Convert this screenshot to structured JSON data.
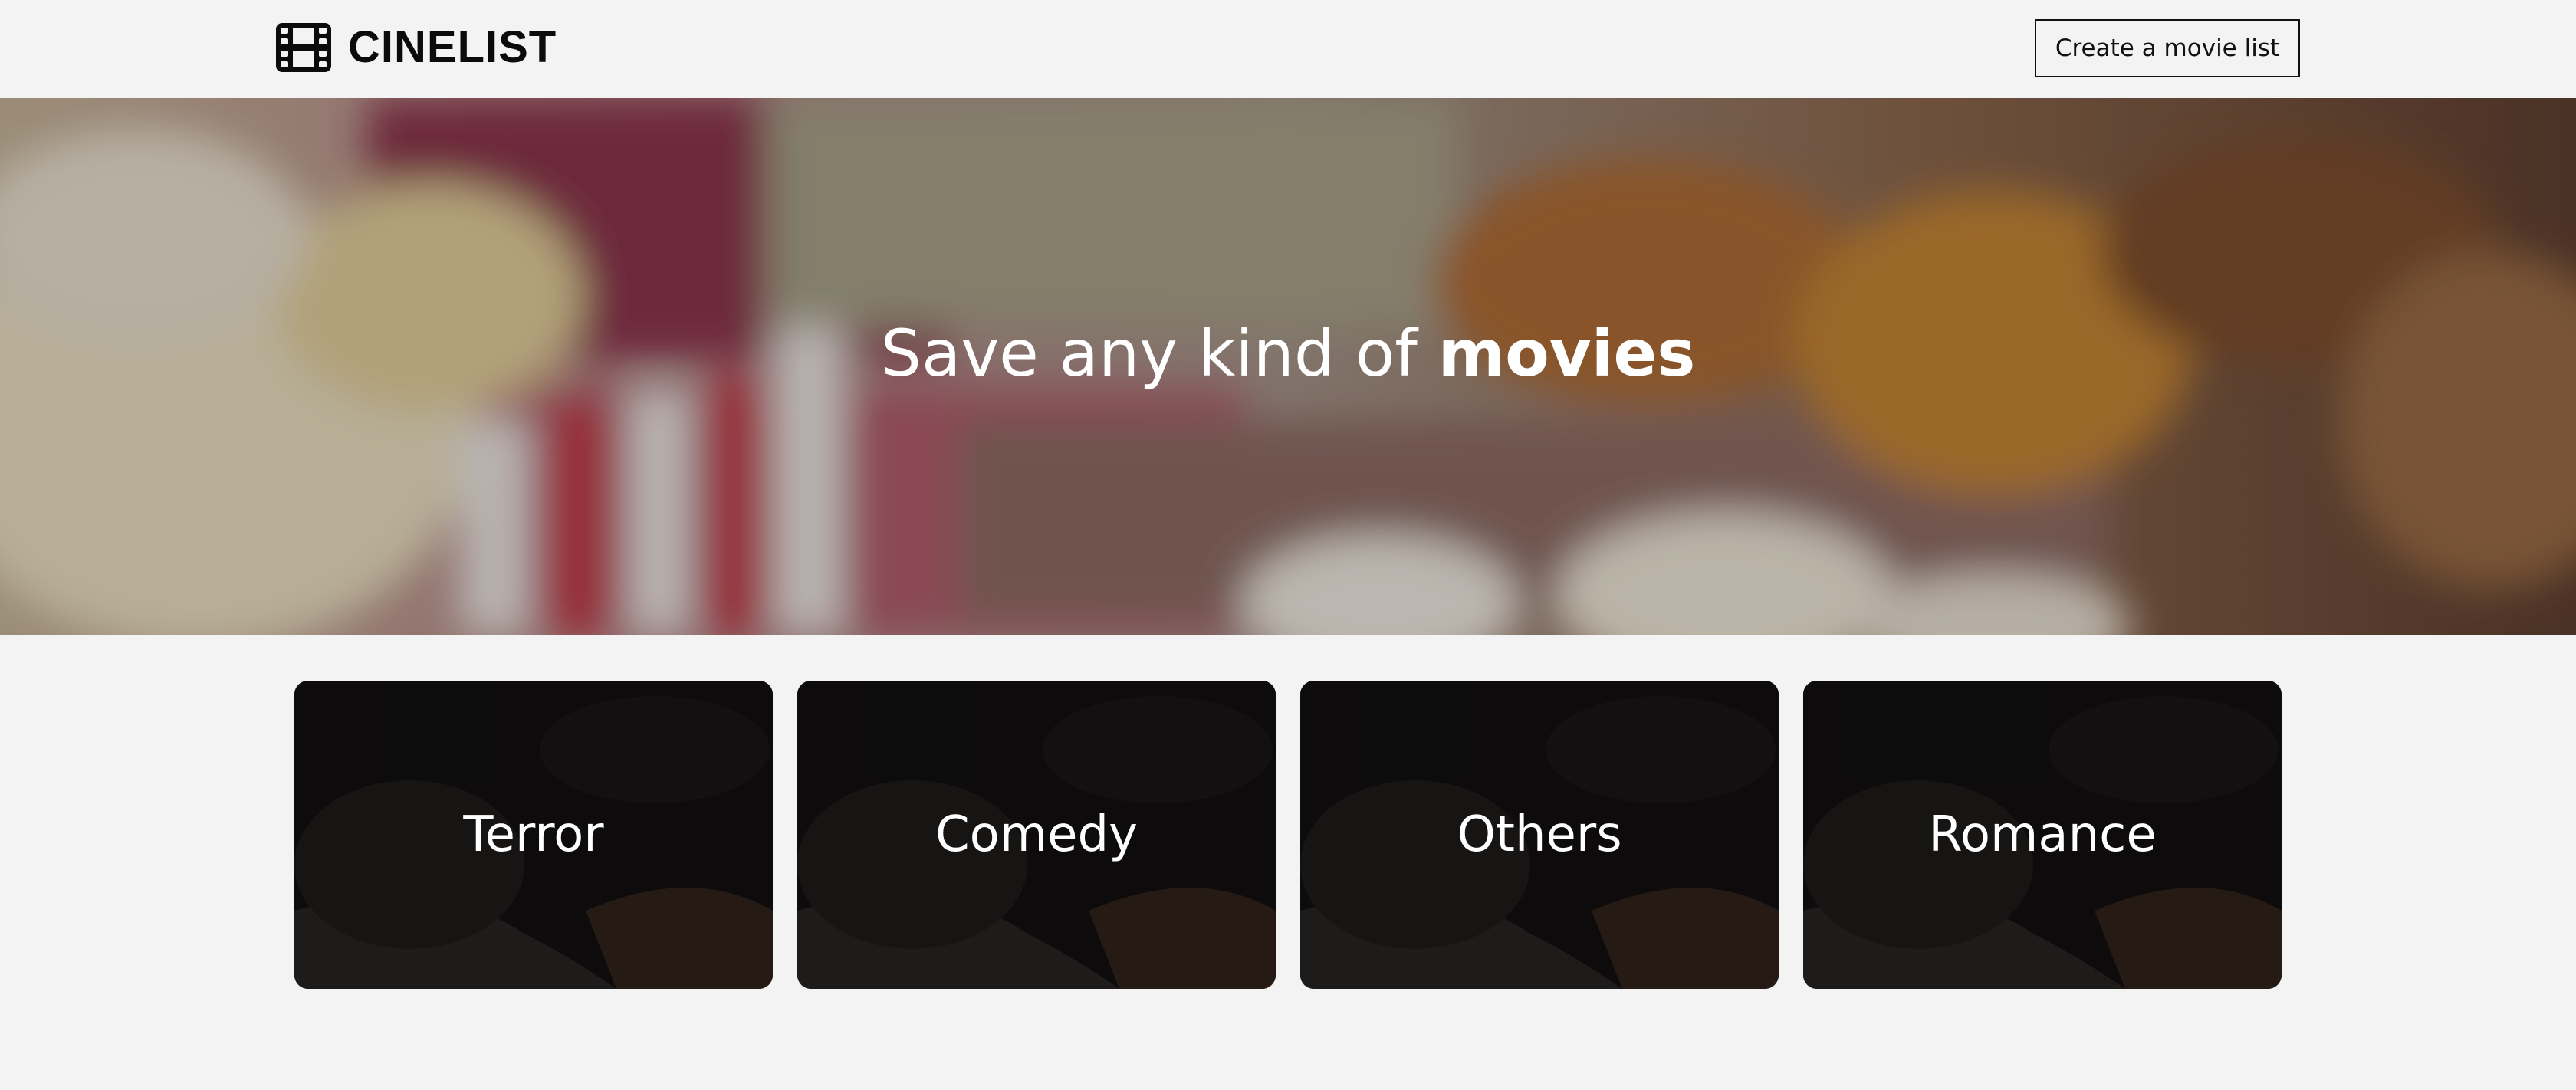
{
  "header": {
    "brand": "CINELIST",
    "brand_icon": "film-icon",
    "create_button": "Create a movie list"
  },
  "hero": {
    "title_prefix": "Save any kind of ",
    "title_emphasis": "movies",
    "background": "popcorn-photo"
  },
  "categories": [
    {
      "label": "Terror"
    },
    {
      "label": "Comedy"
    },
    {
      "label": "Others"
    },
    {
      "label": "Romance"
    }
  ],
  "colors": {
    "page_background": "#f3f3f3",
    "text_dark": "#0b0b0b",
    "text_light": "#ffffff",
    "card_background": "#141212"
  }
}
